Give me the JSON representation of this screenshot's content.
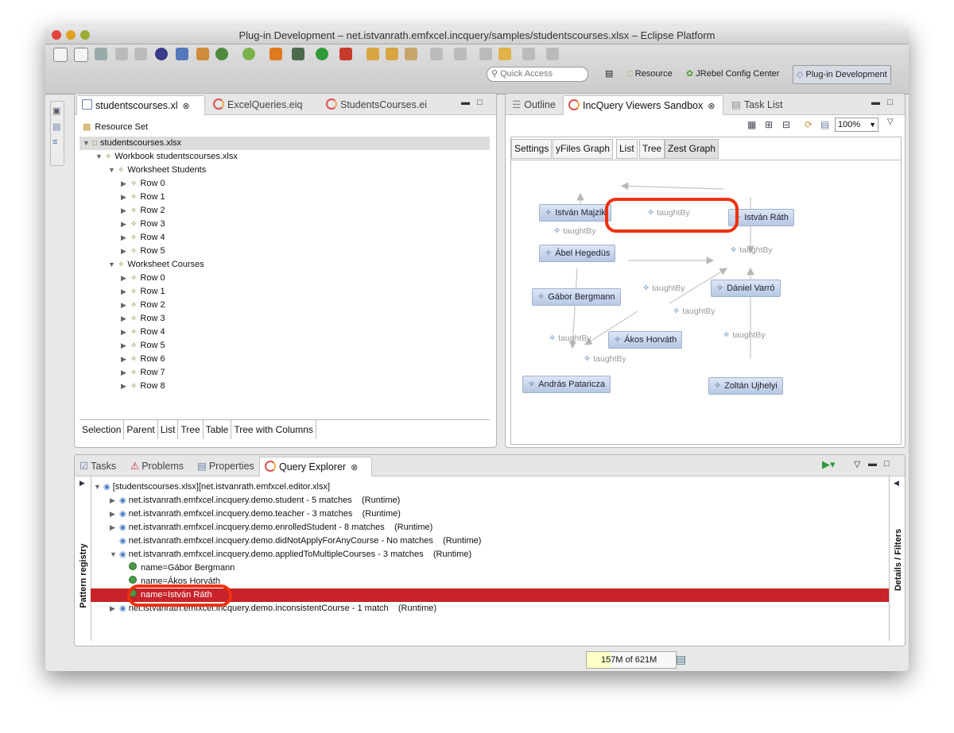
{
  "window": {
    "title": "Plug-in Development – net.istvanrath.emfxcel.incquery/samples/studentscourses.xlsx – Eclipse Platform"
  },
  "toolbar": {
    "quick_access_placeholder": "Quick Access",
    "perspectives": [
      "Resource",
      "JRebel Config Center",
      "Plug-in Development"
    ]
  },
  "editor": {
    "tabs": [
      "studentscourses.xl",
      "ExcelQueries.eiq",
      "StudentsCourses.ei"
    ],
    "root_label": "Resource Set",
    "tree": [
      {
        "label": "studentscourses.xlsx",
        "level": 0,
        "icon": "file-icon"
      },
      {
        "label": "Workbook studentscourses.xlsx",
        "level": 1
      },
      {
        "label": "Worksheet Students",
        "level": 2
      },
      {
        "label": "Row 0",
        "level": 3
      },
      {
        "label": "Row 1",
        "level": 3
      },
      {
        "label": "Row 2",
        "level": 3
      },
      {
        "label": "Row 3",
        "level": 3
      },
      {
        "label": "Row 4",
        "level": 3
      },
      {
        "label": "Row 5",
        "level": 3
      },
      {
        "label": "Worksheet Courses",
        "level": 2
      },
      {
        "label": "Row 0",
        "level": 3
      },
      {
        "label": "Row 1",
        "level": 3
      },
      {
        "label": "Row 2",
        "level": 3
      },
      {
        "label": "Row 3",
        "level": 3
      },
      {
        "label": "Row 4",
        "level": 3
      },
      {
        "label": "Row 5",
        "level": 3
      },
      {
        "label": "Row 6",
        "level": 3
      },
      {
        "label": "Row 7",
        "level": 3
      },
      {
        "label": "Row 8",
        "level": 3
      }
    ],
    "bottom_tabs": [
      "Selection",
      "Parent",
      "List",
      "Tree",
      "Table",
      "Tree with Columns"
    ]
  },
  "viewer": {
    "tabs": [
      "Outline",
      "IncQuery Viewers Sandbox",
      "Task List"
    ],
    "zoom": "100%",
    "view_tabs": [
      "Settings",
      "yFiles Graph",
      "List",
      "Tree",
      "Zest Graph"
    ],
    "active_view_tab": "Zest Graph",
    "nodes": [
      "István Majzik",
      "István Ráth",
      "Ábel Hegedüs",
      "Gábor Bergmann",
      "Dániel Varró",
      "Ákos Horváth",
      "András Pataricza",
      "Zoltán Ujhelyi"
    ],
    "edge_label": "taughtBy"
  },
  "bottom": {
    "tabs": [
      "Tasks",
      "Problems",
      "Properties",
      "Query Explorer"
    ],
    "left_vertical": "Pattern registry",
    "right_vertical": "Details / Filters",
    "root": "[studentscourses.xlsx][net.istvanrath.emfxcel.editor.xlsx]",
    "patterns": [
      {
        "name": "net.istvanrath.emfxcel.incquery.demo.student - 5 matches",
        "mode": "(Runtime)"
      },
      {
        "name": "net.istvanrath.emfxcel.incquery.demo.teacher - 3 matches",
        "mode": "(Runtime)"
      },
      {
        "name": "net.istvanrath.emfxcel.incquery.demo.enrolledStudent - 8 matches",
        "mode": "(Runtime)"
      },
      {
        "name": "net.istvanrath.emfxcel.incquery.demo.didNotApplyForAnyCourse - No matches",
        "mode": "(Runtime)"
      },
      {
        "name": "net.istvanrath.emfxcel.incquery.demo.appliedToMultipleCourses - 3 matches",
        "mode": "(Runtime)"
      }
    ],
    "matches": [
      "name=Gábor Bergmann",
      "name=Ákos Horváth",
      "name=István Ráth"
    ],
    "last_pattern": {
      "name": "net.istvanrath.emfxcel.incquery.demo.inconsistentCourse - 1 match",
      "mode": "(Runtime)"
    }
  },
  "status": {
    "heap": "157M of 621M"
  },
  "colors": {
    "selection_red": "#c8232a",
    "highlight": "#f0300f"
  }
}
